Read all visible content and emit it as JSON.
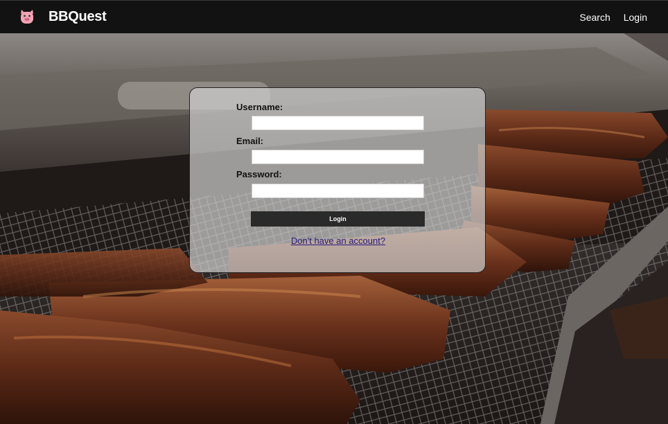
{
  "navbar": {
    "brand": "BBQuest",
    "logo_icon": "pig-icon",
    "links": [
      {
        "label": "Search"
      },
      {
        "label": "Login"
      }
    ]
  },
  "login_form": {
    "username_label": "Username:",
    "username_value": "",
    "email_label": "Email:",
    "email_value": "",
    "password_label": "Password:",
    "password_value": "",
    "submit_label": "Login",
    "signup_link": "Don't have an account?"
  },
  "colors": {
    "navbar_bg": "#121212",
    "logo_pink": "#f4a3b5",
    "button_bg": "#2a2a2a",
    "link_color": "#2b1a7a"
  }
}
